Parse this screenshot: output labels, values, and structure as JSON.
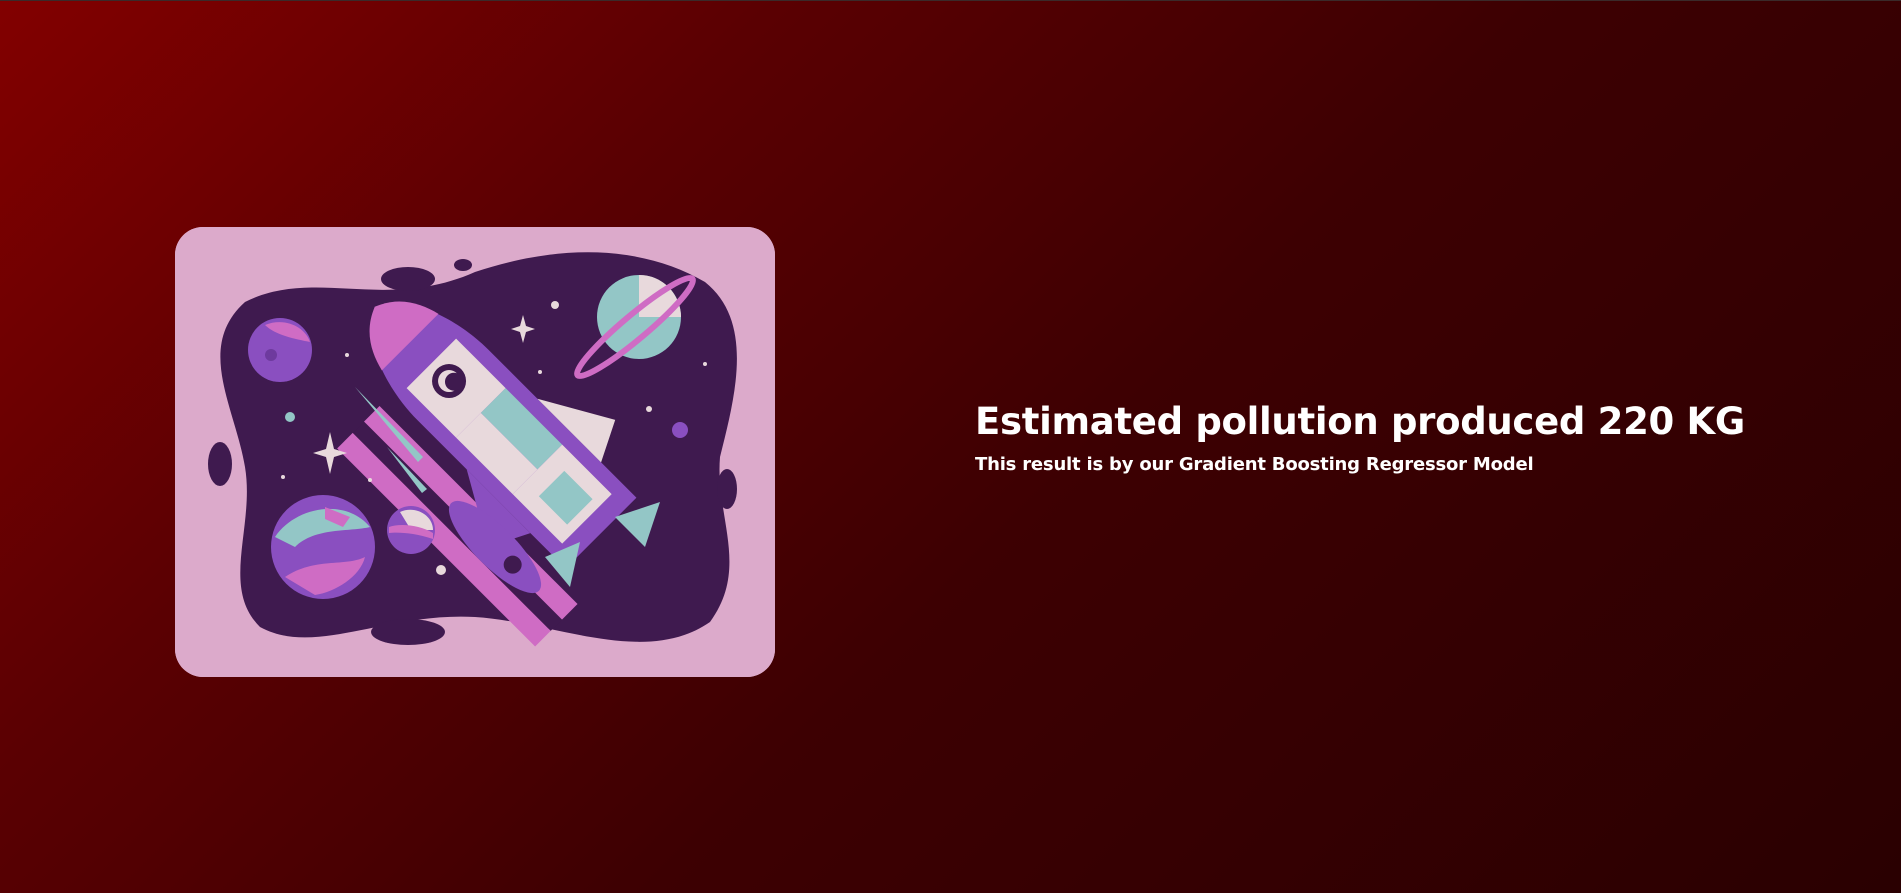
{
  "result": {
    "headline": "Estimated pollution produced 220 KG",
    "subline": "This result is by our Gradient Boosting Regressor Model"
  },
  "illustration": {
    "subject": "rocket-in-space",
    "colors": {
      "card": "#dcaacb",
      "space": "#3f1a4f",
      "purple": "#8a4fc0",
      "pink": "#cf6cc4",
      "teal": "#93c6c6",
      "cream": "#e8d9dc"
    }
  },
  "theme": {
    "background_start": "#820000",
    "background_end": "#2a0001",
    "text": "#ffffff"
  }
}
